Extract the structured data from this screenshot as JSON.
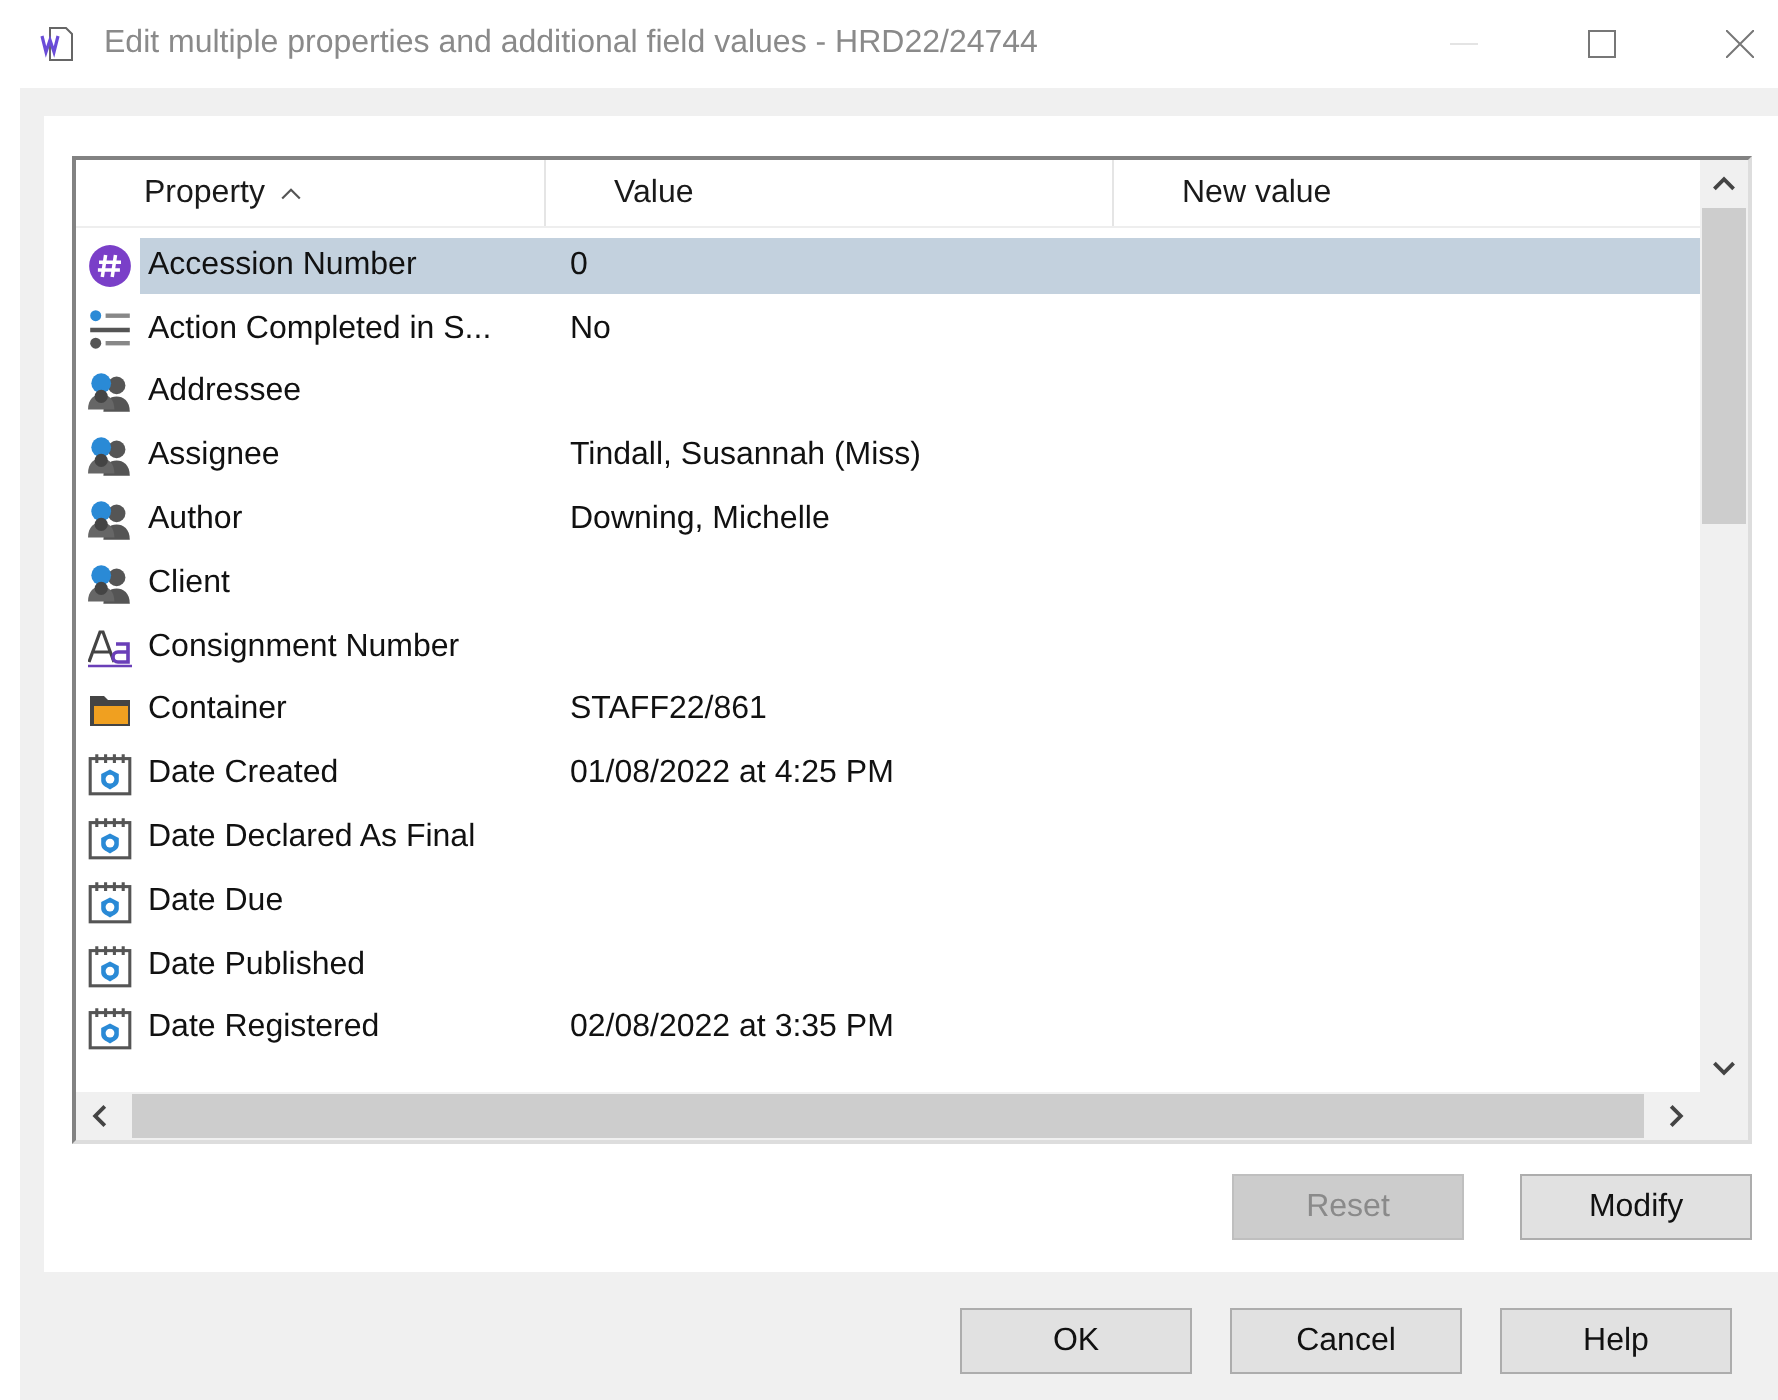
{
  "window": {
    "title": "Edit multiple properties and additional field values - HRD22/24744"
  },
  "table": {
    "columns": [
      {
        "label": "Property",
        "sorted": true
      },
      {
        "label": "Value",
        "sorted": false
      },
      {
        "label": "New value",
        "sorted": false
      }
    ],
    "rows": [
      {
        "kind": "number",
        "property": "Accession Number",
        "value": "0",
        "selected": true
      },
      {
        "kind": "option",
        "property": "Action Completed in S...",
        "value": "No",
        "selected": false
      },
      {
        "kind": "people",
        "property": "Addressee",
        "selected": false
      },
      {
        "kind": "people",
        "property": "Assignee",
        "value": "Tindall, Susannah (Miss)",
        "selected": false
      },
      {
        "kind": "people",
        "property": "Author",
        "value": "Downing, Michelle",
        "selected": false
      },
      {
        "kind": "people",
        "property": "Client",
        "selected": false
      },
      {
        "kind": "text",
        "property": "Consignment Number",
        "selected": false
      },
      {
        "kind": "folder",
        "property": "Container",
        "value": "STAFF22/861",
        "selected": false
      },
      {
        "kind": "date",
        "property": "Date Created",
        "value": "01/08/2022 at 4:25 PM",
        "selected": false
      },
      {
        "kind": "date",
        "property": "Date Declared As Final",
        "selected": false
      },
      {
        "kind": "date",
        "property": "Date Due",
        "selected": false
      },
      {
        "kind": "date",
        "property": "Date Published",
        "selected": false
      },
      {
        "kind": "date",
        "property": "Date Registered",
        "value": "02/08/2022 at 3:35 PM",
        "selected": false
      }
    ]
  },
  "buttons": [
    {
      "label": "Reset",
      "disabled": true
    },
    {
      "label": "Modify",
      "disabled": false
    }
  ],
  "footer_buttons": [
    "OK",
    "Cancel",
    "Help"
  ]
}
